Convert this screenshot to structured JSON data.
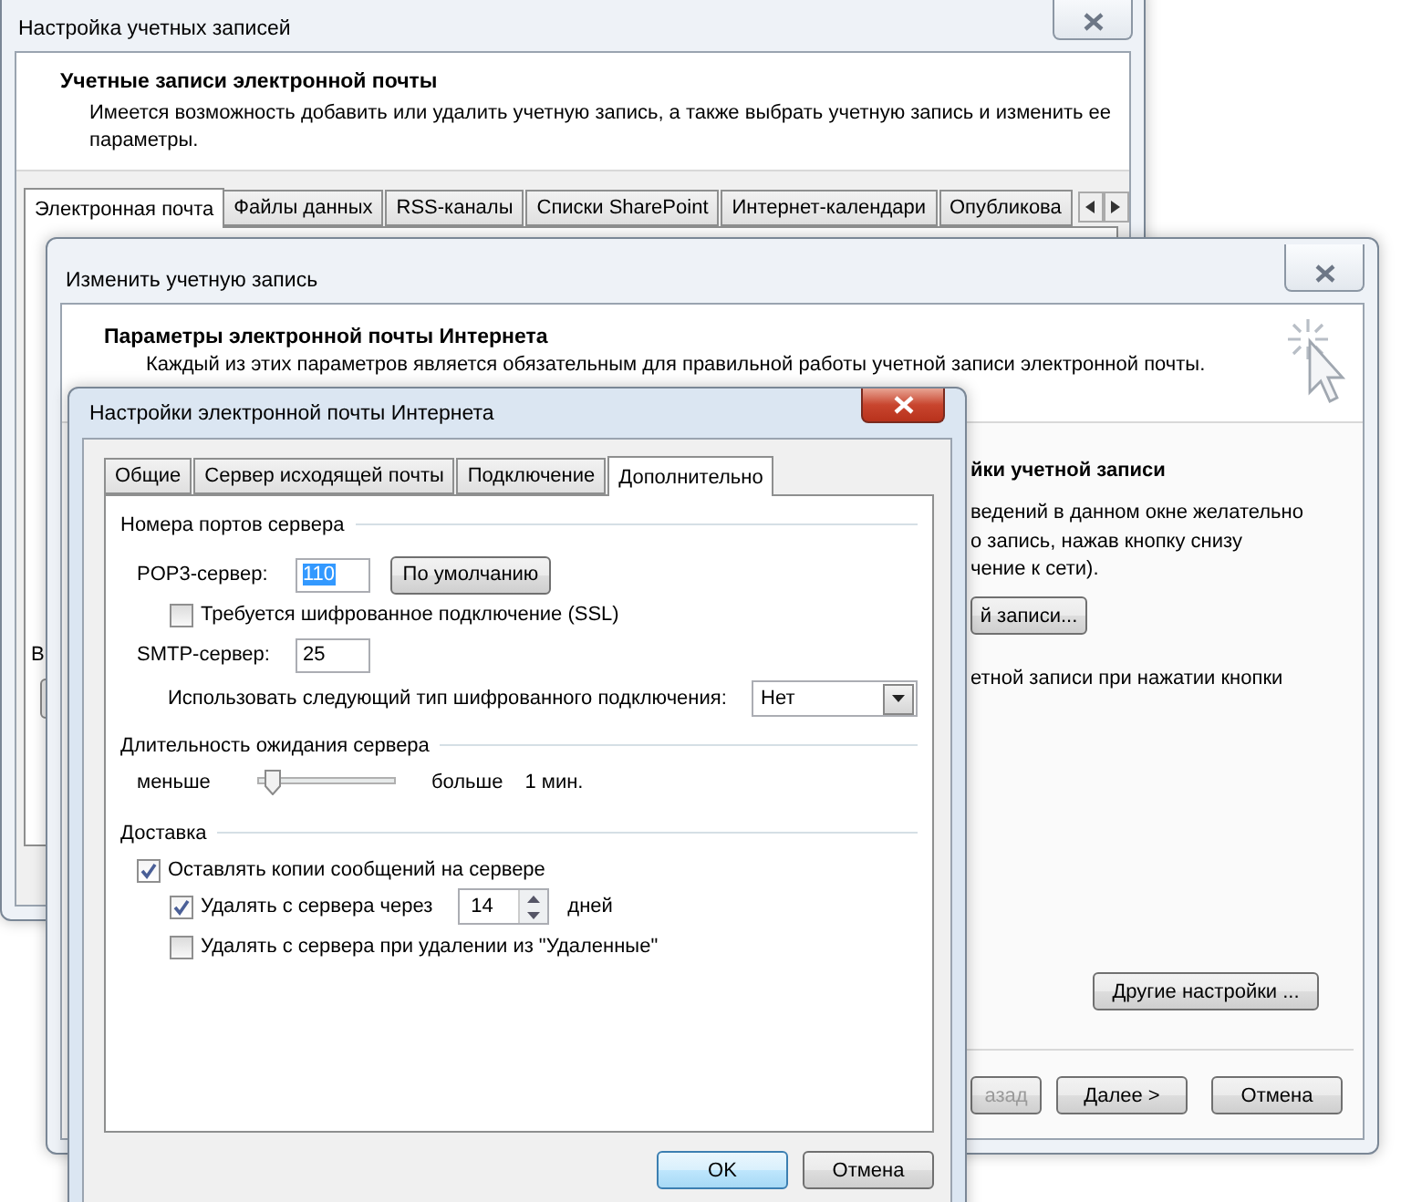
{
  "account_settings": {
    "title": "Настройка учетных записей",
    "heading": "Учетные записи электронной почты",
    "description": "Имеется возможность добавить или удалить учетную запись, а также выбрать учетную запись и изменить ее параметры.",
    "tabs": [
      {
        "label": "Электронная почта",
        "selected": true
      },
      {
        "label": "Файлы данных",
        "selected": false
      },
      {
        "label": "RSS-каналы",
        "selected": false
      },
      {
        "label": "Списки SharePoint",
        "selected": false
      },
      {
        "label": "Интернет-календари",
        "selected": false
      },
      {
        "label": "Опубликова",
        "selected": false
      }
    ],
    "panel_text": "В"
  },
  "change_account": {
    "title": "Изменить учетную запись",
    "heading": "Параметры электронной почты Интернета",
    "description": "Каждый из этих параметров является обязательным для правильной работы учетной записи электронной почты.",
    "section_heading": "йки учетной записи",
    "section_lines": [
      "ведений в данном окне желательно",
      "о запись, нажав кнопку снизу",
      "чение к сети)."
    ],
    "test_button": "й записи...",
    "note": "етной записи при нажатии кнопки",
    "more_button": "Другие настройки ...",
    "buttons": [
      {
        "label": "азад",
        "disabled": true
      },
      {
        "label": "Далее >",
        "disabled": false
      },
      {
        "label": "Отмена",
        "disabled": false
      }
    ]
  },
  "internet_settings": {
    "title": "Настройки электронной почты Интернета",
    "tabs": [
      {
        "label": "Общие",
        "selected": false
      },
      {
        "label": "Сервер исходящей почты",
        "selected": false
      },
      {
        "label": "Подключение",
        "selected": false
      },
      {
        "label": "Дополнительно",
        "selected": true
      }
    ],
    "ports": {
      "title": "Номера портов сервера",
      "pop3_label": "POP3-сервер:",
      "pop3_value": "110",
      "pop3_highlighted": true,
      "default_button": "По умолчанию",
      "ssl": {
        "label": "Требуется шифрованное подключение (SSL)",
        "checked": false
      },
      "smtp_label": "SMTP-сервер:",
      "smtp_value": "25",
      "encryption_label": "Использовать следующий тип шифрованного подключения:",
      "encryption_value": "Нет"
    },
    "timeout": {
      "title": "Длительность ожидания сервера",
      "min_label": "меньше",
      "max_label": "больше",
      "level": 0.1,
      "value": "1 мин."
    },
    "delivery": {
      "title": "Доставка",
      "options": [
        {
          "label": "Оставлять копии сообщений на сервере",
          "checked": true,
          "children": [
            {
              "label": "Удалять с сервера через",
              "checked": true,
              "days": "14",
              "unit": "дней"
            },
            {
              "label": "Удалять с сервера при удалении из \"Удаленные\"",
              "checked": false
            }
          ]
        }
      ]
    },
    "buttons": [
      "OK",
      "Отмена"
    ]
  }
}
